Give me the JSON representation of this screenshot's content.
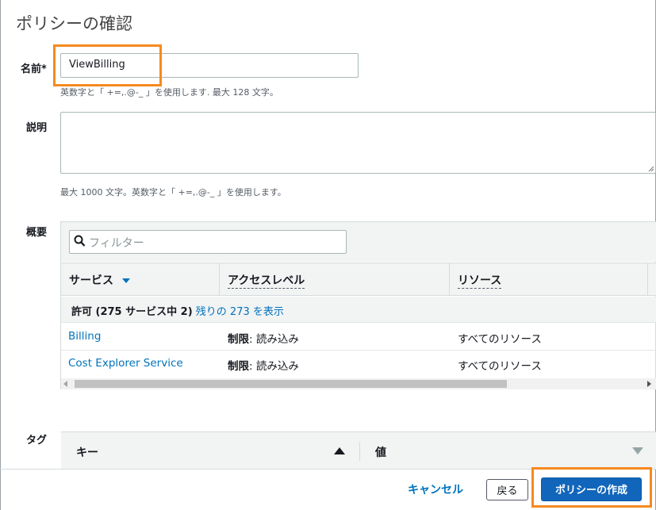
{
  "page": {
    "title": "ポリシーの確認"
  },
  "name_field": {
    "label": "名前*",
    "value": "ViewBilling",
    "hint": "英数字と「 +=,.@-_ 」を使用します. 最大 128 文字。"
  },
  "description_field": {
    "label": "説明",
    "value": "",
    "hint": "最大 1000 文字。英数字と「 +=,.@-_ 」を使用します。"
  },
  "summary": {
    "label": "概要",
    "filter_placeholder": "フィルター",
    "columns": [
      "サービス",
      "アクセスレベル",
      "リソース"
    ],
    "group": {
      "prefix": "許可 (275 サービス中 2)",
      "link": "残りの 273 を表示"
    },
    "rows": [
      {
        "service": "Billing",
        "access_bold": "制限",
        "access_rest": ": 読み込み",
        "resource": "すべてのリソース"
      },
      {
        "service": "Cost Explorer Service",
        "access_bold": "制限",
        "access_rest": ": 読み込み",
        "resource": "すべてのリソース"
      }
    ]
  },
  "tags": {
    "label": "タグ",
    "col_key": "キー",
    "col_value": "値"
  },
  "footer": {
    "cancel": "キャンセル",
    "back": "戻る",
    "create": "ポリシーの作成"
  },
  "colors": {
    "primary": "#1166bb",
    "link": "#0073bb",
    "highlight": "#f58a1f"
  }
}
